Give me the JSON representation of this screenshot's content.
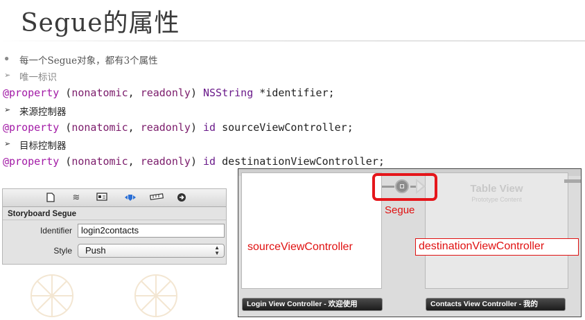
{
  "title": "Segue的属性",
  "bullet_intro": "每一个Segue对象，都有3个属性",
  "sub1": "唯一标识",
  "code1": {
    "at": "@property",
    "open": " (",
    "p1": "nonatomic",
    "comma": ", ",
    "p2": "readonly",
    "close": ") ",
    "type": "NSString",
    "rest": " *identifier;"
  },
  "sub2": "来源控制器",
  "code2": {
    "at": "@property",
    "open": " (",
    "p1": "nonatomic",
    "comma": ", ",
    "p2": "readonly",
    "close": ") ",
    "type": "id",
    "rest": " sourceViewController;"
  },
  "sub3": "目标控制器",
  "code3": {
    "at": "@property",
    "open": " (",
    "p1": "nonatomic",
    "comma": ", ",
    "p2": "readonly",
    "close": ") ",
    "type": "id",
    "rest": " destinationViewController;"
  },
  "inspector": {
    "header": "Storyboard Segue",
    "identifier_label": "Identifier",
    "identifier_value": "login2contacts",
    "style_label": "Style",
    "style_value": "Push",
    "tab_icons": [
      "file-icon",
      "quick-help-icon",
      "identity-icon",
      "attributes-icon",
      "size-icon",
      "connections-icon"
    ]
  },
  "storyboard": {
    "table_view_title": "Table View",
    "table_view_sub": "Prototype Content",
    "segue_label": "Segue",
    "source_label": "sourceViewController",
    "dest_label": "destinationViewController",
    "login_caption": "Login View Controller - 欢迎使用",
    "contacts_caption": "Contacts View Controller - 我的"
  },
  "colors": {
    "annotation_red": "#e01010",
    "keyword_purple": "#a21aa6"
  }
}
